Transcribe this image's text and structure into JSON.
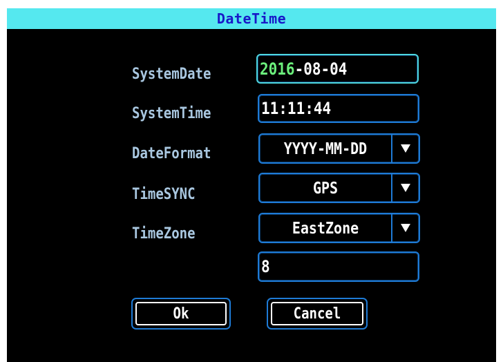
{
  "dialog": {
    "title": "DateTime"
  },
  "fields": {
    "system_date": {
      "label": "SystemDate",
      "year": "2016",
      "rest": "-08-04"
    },
    "system_time": {
      "label": "SystemTime",
      "value": "11:11:44"
    },
    "date_format": {
      "label": "DateFormat",
      "value": "YYYY-MM-DD"
    },
    "time_sync": {
      "label": "TimeSYNC",
      "value": "GPS"
    },
    "time_zone": {
      "label": "TimeZone",
      "value": "EastZone"
    },
    "zone_offset": {
      "value": "8"
    }
  },
  "buttons": {
    "ok": "Ok",
    "cancel": "Cancel"
  },
  "icons": {
    "dropdown": "triangle-down-icon"
  },
  "colors": {
    "title_bar": "#55e8ef",
    "title_text": "#1818c8",
    "label_text": "#a9c7e0",
    "field_border": "#1e7bd6",
    "active_border": "#4fd8e0",
    "year_highlight": "#6cf07c",
    "background": "#000000"
  }
}
